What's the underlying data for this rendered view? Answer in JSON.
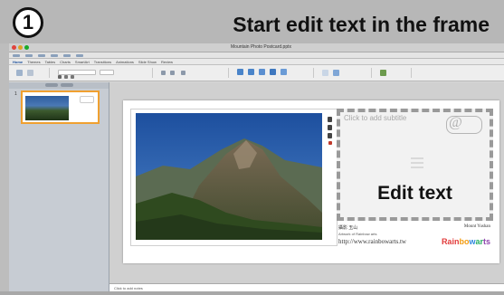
{
  "header": {
    "step_number": "1",
    "headline": "Start edit text in the frame"
  },
  "app": {
    "document_title": "Mountain Photo Postcard.pptx",
    "toolbar_buttons": [
      "new-icon",
      "open-icon",
      "save-icon",
      "print-icon",
      "undo-icon",
      "redo-icon"
    ],
    "ribbon_tabs": [
      "Home",
      "Themes",
      "Tables",
      "Charts",
      "SmartArt",
      "Transitions",
      "Animations",
      "Slide Show",
      "Review"
    ],
    "active_ribbon_tab": "Home"
  },
  "sidebar": {
    "slides": [
      {
        "number": "1",
        "selected": true
      }
    ]
  },
  "slide": {
    "subtitle_placeholder": "Click to add subtitle",
    "edit_label": "Edit text",
    "credit_name": "攝影 玉山",
    "credit_right": "Mount Yushan",
    "credit_small": "Artwork of Rainbow arts",
    "url": "http://www.rainbowarts.tw",
    "brand": [
      "Rain",
      "bo",
      "w",
      "ar",
      "ts"
    ]
  },
  "notes": {
    "placeholder": "Click to add notes"
  },
  "colors": {
    "accent_selection": "#f0a030",
    "dashed_frame": "#9a9a9a"
  }
}
